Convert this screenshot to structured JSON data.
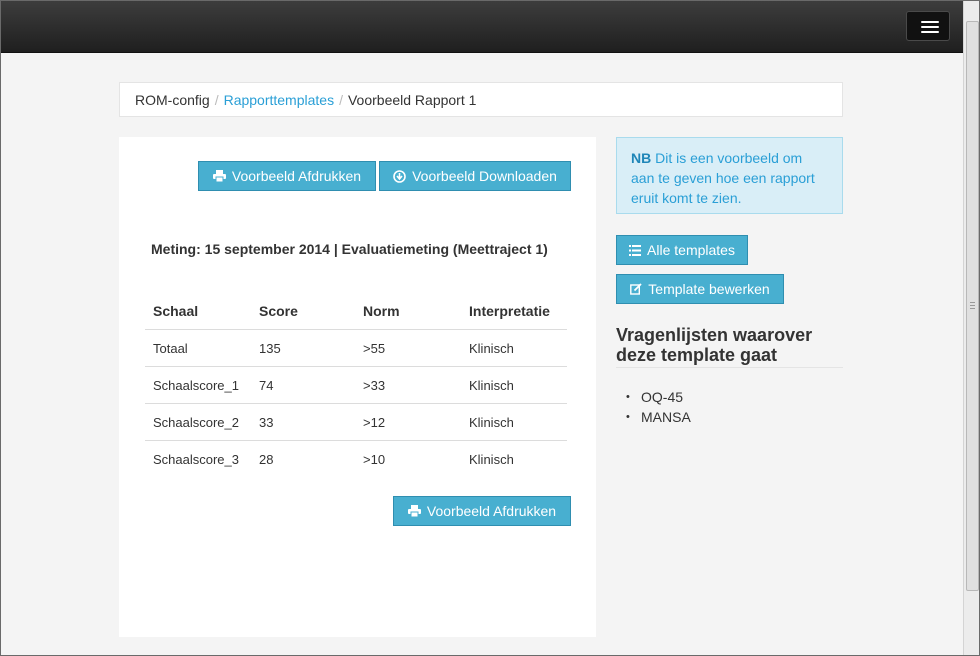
{
  "breadcrumb": {
    "items": [
      "ROM-config",
      "Rapporttemplates",
      "Voorbeeld Rapport 1"
    ]
  },
  "actions": {
    "print_label": "Voorbeeld Afdrukken",
    "download_label": "Voorbeeld Downloaden"
  },
  "report": {
    "meting": "Meting: 15 september 2014 | Evaluatiemeting (Meettraject 1)",
    "columns": [
      "Schaal",
      "Score",
      "Norm",
      "Interpretatie"
    ],
    "rows": [
      [
        "Totaal",
        "135",
        ">55",
        "Klinisch"
      ],
      [
        "Schaalscore_1",
        "74",
        ">33",
        "Klinisch"
      ],
      [
        "Schaalscore_2",
        "33",
        ">12",
        "Klinisch"
      ],
      [
        "Schaalscore_3",
        "28",
        ">10",
        "Klinisch"
      ]
    ]
  },
  "notice": {
    "strong": "NB",
    "text": "Dit is een voorbeeld om aan te geven hoe een rapport eruit komt te zien."
  },
  "sidebar": {
    "all_templates_label": "Alle templates",
    "edit_template_label": "Template bewerken",
    "heading": "Vragenlijsten waarover deze template gaat",
    "questionnaires": [
      "OQ-45",
      "MANSA"
    ]
  },
  "colors": {
    "button": "#48afd0",
    "link": "#2a9fd6",
    "alert_bg": "#d9eef7"
  }
}
